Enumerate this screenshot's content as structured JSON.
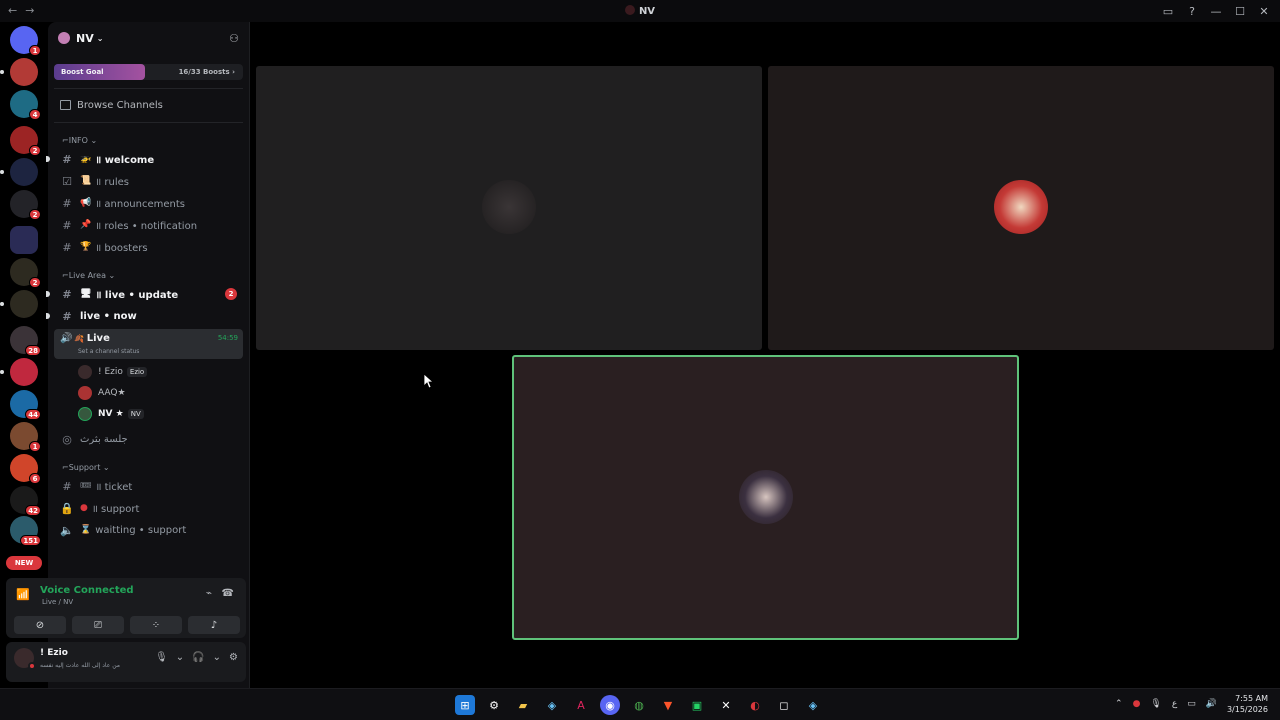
{
  "window": {
    "title": "NV",
    "back_icon": "←",
    "forward_icon": "→",
    "controls": [
      "inbox-icon",
      "help-icon",
      "minimize",
      "maximize",
      "close"
    ]
  },
  "server_badges": [
    "1",
    "",
    "4",
    "2",
    "",
    "2",
    "",
    "2",
    "",
    "28",
    "",
    "44",
    "1",
    "6",
    "42",
    "151",
    "NEW"
  ],
  "guild": {
    "name": "NV",
    "boost_label": "Boost Goal",
    "boost_count": "16/33 Boosts ›",
    "boost_progress": 0.48,
    "browse_channels": "Browse Channels"
  },
  "categories": {
    "info": "INFO",
    "live_area": "Live Area",
    "support": "Support"
  },
  "channels": {
    "welcome": "॥ welcome",
    "rules": "॥ rules",
    "announcements": "॥ announcements",
    "roles": "॥ roles • notification",
    "boosters": "॥ boosters",
    "live_update": "॥ live • update",
    "live_update_badge": "2",
    "live_now": "live • now",
    "voice_live": "Live",
    "voice_live_status": "Set a channel status",
    "voice_live_time": "54:59",
    "stage": "جلسة بثرث",
    "ticket": "॥ ticket",
    "support": "॥ support",
    "waiting": "waitting • support"
  },
  "voice_users": [
    {
      "name": "! Ezio",
      "tag": "Ezio"
    },
    {
      "name": "AAQ★",
      "tag": ""
    },
    {
      "name": "NV ★",
      "tag": "NV"
    }
  ],
  "voice_panel": {
    "status": "Voice Connected",
    "location": "Live / NV"
  },
  "user": {
    "name": "! Ezio",
    "status": "من عاد إلى الله عادت إليه نفسه"
  },
  "colors": {
    "accent_green": "#23a55a",
    "badge_red": "#da373c",
    "tile_1": "#201f20",
    "tile_2": "#1f1a1a",
    "tile_3": "#2a1f21"
  },
  "clock": {
    "time": "7:55 AM",
    "date": "3/15/2026"
  }
}
